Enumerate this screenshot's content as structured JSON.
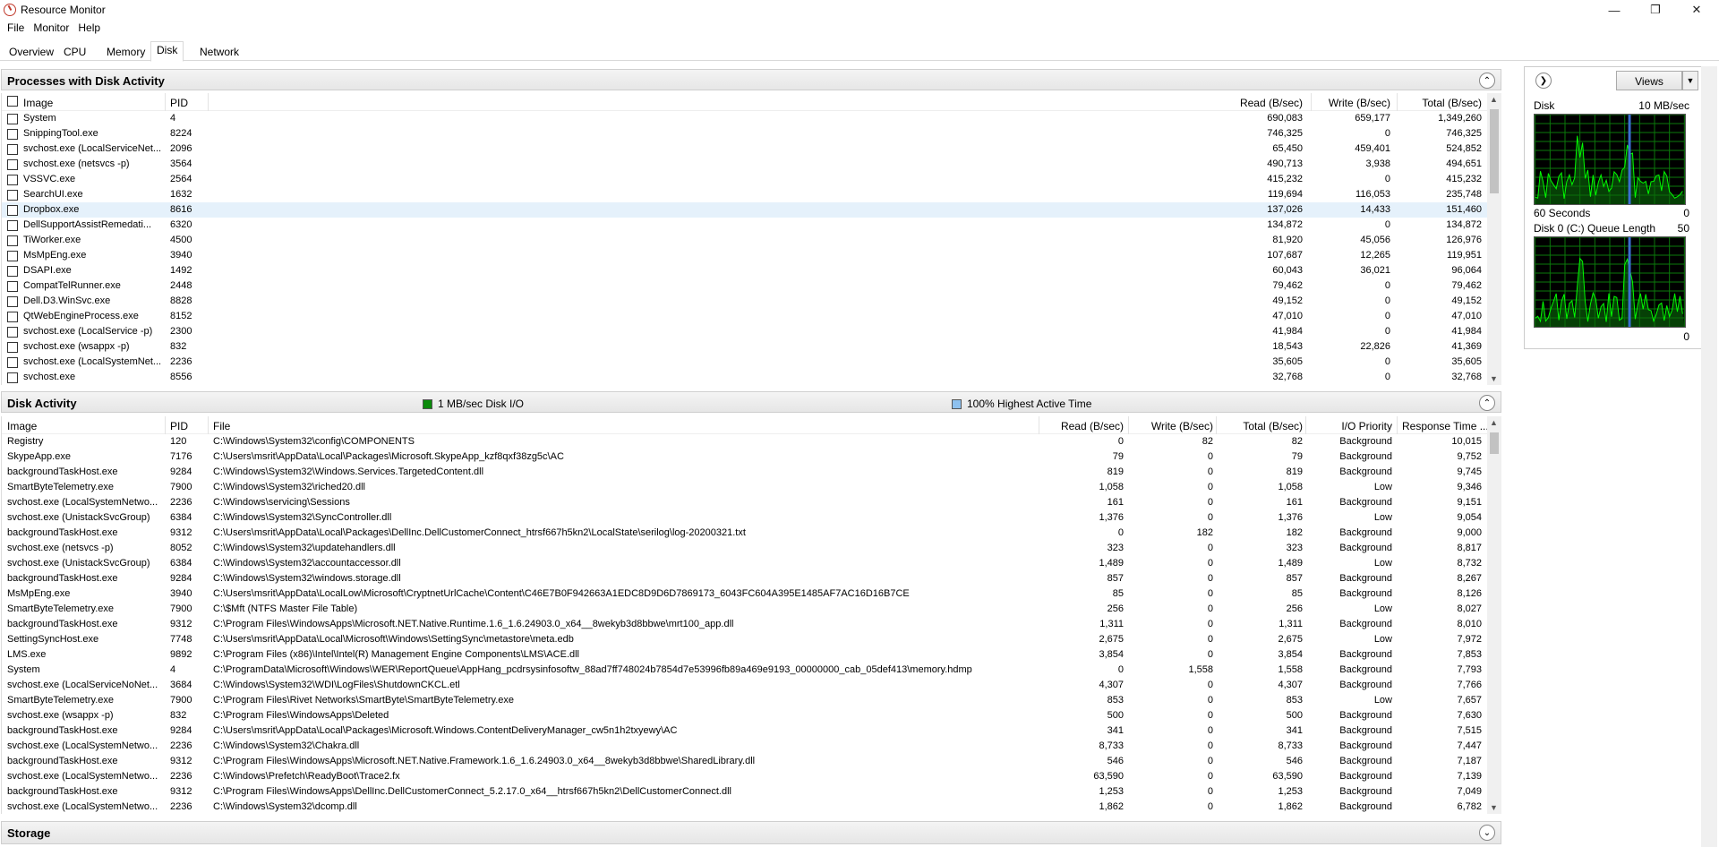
{
  "window": {
    "title": "Resource Monitor",
    "minimize": "—",
    "maximize": "❐",
    "close": "✕"
  },
  "menu": [
    "File",
    "Monitor",
    "Help"
  ],
  "tabs": [
    "Overview",
    "CPU",
    "Memory",
    "Disk",
    "Network"
  ],
  "processes": {
    "title": "Processes with Disk Activity",
    "columns": {
      "image": "Image",
      "pid": "PID",
      "read": "Read (B/sec)",
      "write": "Write (B/sec)",
      "total": "Total (B/sec)"
    },
    "rows": [
      {
        "image": "System",
        "pid": "4",
        "read": "690,083",
        "write": "659,177",
        "total": "1,349,260"
      },
      {
        "image": "SnippingTool.exe",
        "pid": "8224",
        "read": "746,325",
        "write": "0",
        "total": "746,325"
      },
      {
        "image": "svchost.exe (LocalServiceNet...",
        "pid": "2096",
        "read": "65,450",
        "write": "459,401",
        "total": "524,852"
      },
      {
        "image": "svchost.exe (netsvcs -p)",
        "pid": "3564",
        "read": "490,713",
        "write": "3,938",
        "total": "494,651"
      },
      {
        "image": "VSSVC.exe",
        "pid": "2564",
        "read": "415,232",
        "write": "0",
        "total": "415,232"
      },
      {
        "image": "SearchUI.exe",
        "pid": "1632",
        "read": "119,694",
        "write": "116,053",
        "total": "235,748"
      },
      {
        "image": "Dropbox.exe",
        "pid": "8616",
        "read": "137,026",
        "write": "14,433",
        "total": "151,460"
      },
      {
        "image": "DellSupportAssistRemedati...",
        "pid": "6320",
        "read": "134,872",
        "write": "0",
        "total": "134,872"
      },
      {
        "image": "TiWorker.exe",
        "pid": "4500",
        "read": "81,920",
        "write": "45,056",
        "total": "126,976"
      },
      {
        "image": "MsMpEng.exe",
        "pid": "3940",
        "read": "107,687",
        "write": "12,265",
        "total": "119,951"
      },
      {
        "image": "DSAPI.exe",
        "pid": "1492",
        "read": "60,043",
        "write": "36,021",
        "total": "96,064"
      },
      {
        "image": "CompatTelRunner.exe",
        "pid": "2448",
        "read": "79,462",
        "write": "0",
        "total": "79,462"
      },
      {
        "image": "Dell.D3.WinSvc.exe",
        "pid": "8828",
        "read": "49,152",
        "write": "0",
        "total": "49,152"
      },
      {
        "image": "QtWebEngineProcess.exe",
        "pid": "8152",
        "read": "47,010",
        "write": "0",
        "total": "47,010"
      },
      {
        "image": "svchost.exe (LocalService -p)",
        "pid": "2300",
        "read": "41,984",
        "write": "0",
        "total": "41,984"
      },
      {
        "image": "svchost.exe (wsappx -p)",
        "pid": "832",
        "read": "18,543",
        "write": "22,826",
        "total": "41,369"
      },
      {
        "image": "svchost.exe (LocalSystemNet...",
        "pid": "2236",
        "read": "35,605",
        "write": "0",
        "total": "35,605"
      },
      {
        "image": "svchost.exe",
        "pid": "8556",
        "read": "32,768",
        "write": "0",
        "total": "32,768"
      }
    ]
  },
  "disk_activity": {
    "title": "Disk Activity",
    "legend_io": "1 MB/sec Disk I/O",
    "legend_active": "100% Highest Active Time",
    "colors": {
      "io": "#0a8a0a",
      "active": "#8ec1ef",
      "graph_line": "#00ff00",
      "graph_grid": "#0b7a0b"
    },
    "columns": {
      "image": "Image",
      "pid": "PID",
      "file": "File",
      "read": "Read (B/sec)",
      "write": "Write (B/sec)",
      "total": "Total (B/sec)",
      "priority": "I/O Priority",
      "response": "Response Time ..."
    },
    "rows": [
      {
        "image": "Registry",
        "pid": "120",
        "file": "C:\\Windows\\System32\\config\\COMPONENTS",
        "read": "0",
        "write": "82",
        "total": "82",
        "priority": "Background",
        "response": "10,015"
      },
      {
        "image": "SkypeApp.exe",
        "pid": "7176",
        "file": "C:\\Users\\msrit\\AppData\\Local\\Packages\\Microsoft.SkypeApp_kzf8qxf38zg5c\\AC",
        "read": "79",
        "write": "0",
        "total": "79",
        "priority": "Background",
        "response": "9,752"
      },
      {
        "image": "backgroundTaskHost.exe",
        "pid": "9284",
        "file": "C:\\Windows\\System32\\Windows.Services.TargetedContent.dll",
        "read": "819",
        "write": "0",
        "total": "819",
        "priority": "Background",
        "response": "9,745"
      },
      {
        "image": "SmartByteTelemetry.exe",
        "pid": "7900",
        "file": "C:\\Windows\\System32\\riched20.dll",
        "read": "1,058",
        "write": "0",
        "total": "1,058",
        "priority": "Low",
        "response": "9,346"
      },
      {
        "image": "svchost.exe (LocalSystemNetwo...",
        "pid": "2236",
        "file": "C:\\Windows\\servicing\\Sessions",
        "read": "161",
        "write": "0",
        "total": "161",
        "priority": "Background",
        "response": "9,151"
      },
      {
        "image": "svchost.exe (UnistackSvcGroup)",
        "pid": "6384",
        "file": "C:\\Windows\\System32\\SyncController.dll",
        "read": "1,376",
        "write": "0",
        "total": "1,376",
        "priority": "Low",
        "response": "9,054"
      },
      {
        "image": "backgroundTaskHost.exe",
        "pid": "9312",
        "file": "C:\\Users\\msrit\\AppData\\Local\\Packages\\DellInc.DellCustomerConnect_htrsf667h5kn2\\LocalState\\serilog\\log-20200321.txt",
        "read": "0",
        "write": "182",
        "total": "182",
        "priority": "Background",
        "response": "9,000"
      },
      {
        "image": "svchost.exe (netsvcs -p)",
        "pid": "8052",
        "file": "C:\\Windows\\System32\\updatehandlers.dll",
        "read": "323",
        "write": "0",
        "total": "323",
        "priority": "Background",
        "response": "8,817"
      },
      {
        "image": "svchost.exe (UnistackSvcGroup)",
        "pid": "6384",
        "file": "C:\\Windows\\System32\\accountaccessor.dll",
        "read": "1,489",
        "write": "0",
        "total": "1,489",
        "priority": "Low",
        "response": "8,732"
      },
      {
        "image": "backgroundTaskHost.exe",
        "pid": "9284",
        "file": "C:\\Windows\\System32\\windows.storage.dll",
        "read": "857",
        "write": "0",
        "total": "857",
        "priority": "Background",
        "response": "8,267"
      },
      {
        "image": "MsMpEng.exe",
        "pid": "3940",
        "file": "C:\\Users\\msrit\\AppData\\LocalLow\\Microsoft\\CryptnetUrlCache\\Content\\C46E7B0F942663A1EDC8D9D6D7869173_6043FC604A395E1485AF7AC16D16B7CE",
        "read": "85",
        "write": "0",
        "total": "85",
        "priority": "Background",
        "response": "8,126"
      },
      {
        "image": "SmartByteTelemetry.exe",
        "pid": "7900",
        "file": "C:\\$Mft (NTFS Master File Table)",
        "read": "256",
        "write": "0",
        "total": "256",
        "priority": "Low",
        "response": "8,027"
      },
      {
        "image": "backgroundTaskHost.exe",
        "pid": "9312",
        "file": "C:\\Program Files\\WindowsApps\\Microsoft.NET.Native.Runtime.1.6_1.6.24903.0_x64__8wekyb3d8bbwe\\mrt100_app.dll",
        "read": "1,311",
        "write": "0",
        "total": "1,311",
        "priority": "Background",
        "response": "8,010"
      },
      {
        "image": "SettingSyncHost.exe",
        "pid": "7748",
        "file": "C:\\Users\\msrit\\AppData\\Local\\Microsoft\\Windows\\SettingSync\\metastore\\meta.edb",
        "read": "2,675",
        "write": "0",
        "total": "2,675",
        "priority": "Low",
        "response": "7,972"
      },
      {
        "image": "LMS.exe",
        "pid": "9892",
        "file": "C:\\Program Files (x86)\\Intel\\Intel(R) Management Engine Components\\LMS\\ACE.dll",
        "read": "3,854",
        "write": "0",
        "total": "3,854",
        "priority": "Background",
        "response": "7,853"
      },
      {
        "image": "System",
        "pid": "4",
        "file": "C:\\ProgramData\\Microsoft\\Windows\\WER\\ReportQueue\\AppHang_pcdrsysinfosoftw_88ad7ff748024b7854d7e53996fb89a469e9193_00000000_cab_05def413\\memory.hdmp",
        "read": "0",
        "write": "1,558",
        "total": "1,558",
        "priority": "Background",
        "response": "7,793"
      },
      {
        "image": "svchost.exe (LocalServiceNoNet...",
        "pid": "3684",
        "file": "C:\\Windows\\System32\\WDI\\LogFiles\\ShutdownCKCL.etl",
        "read": "4,307",
        "write": "0",
        "total": "4,307",
        "priority": "Background",
        "response": "7,766"
      },
      {
        "image": "SmartByteTelemetry.exe",
        "pid": "7900",
        "file": "C:\\Program Files\\Rivet Networks\\SmartByte\\SmartByteTelemetry.exe",
        "read": "853",
        "write": "0",
        "total": "853",
        "priority": "Low",
        "response": "7,657"
      },
      {
        "image": "svchost.exe (wsappx -p)",
        "pid": "832",
        "file": "C:\\Program Files\\WindowsApps\\Deleted",
        "read": "500",
        "write": "0",
        "total": "500",
        "priority": "Background",
        "response": "7,630"
      },
      {
        "image": "backgroundTaskHost.exe",
        "pid": "9284",
        "file": "C:\\Users\\msrit\\AppData\\Local\\Packages\\Microsoft.Windows.ContentDeliveryManager_cw5n1h2txyewy\\AC",
        "read": "341",
        "write": "0",
        "total": "341",
        "priority": "Background",
        "response": "7,515"
      },
      {
        "image": "svchost.exe (LocalSystemNetwo...",
        "pid": "2236",
        "file": "C:\\Windows\\System32\\Chakra.dll",
        "read": "8,733",
        "write": "0",
        "total": "8,733",
        "priority": "Background",
        "response": "7,447"
      },
      {
        "image": "backgroundTaskHost.exe",
        "pid": "9312",
        "file": "C:\\Program Files\\WindowsApps\\Microsoft.NET.Native.Framework.1.6_1.6.24903.0_x64__8wekyb3d8bbwe\\SharedLibrary.dll",
        "read": "546",
        "write": "0",
        "total": "546",
        "priority": "Background",
        "response": "7,187"
      },
      {
        "image": "svchost.exe (LocalSystemNetwo...",
        "pid": "2236",
        "file": "C:\\Windows\\Prefetch\\ReadyBoot\\Trace2.fx",
        "read": "63,590",
        "write": "0",
        "total": "63,590",
        "priority": "Background",
        "response": "7,139"
      },
      {
        "image": "backgroundTaskHost.exe",
        "pid": "9312",
        "file": "C:\\Program Files\\WindowsApps\\DellInc.DellCustomerConnect_5.2.17.0_x64__htrsf667h5kn2\\DellCustomerConnect.dll",
        "read": "1,253",
        "write": "0",
        "total": "1,253",
        "priority": "Background",
        "response": "7,049"
      },
      {
        "image": "svchost.exe (LocalSystemNetwo...",
        "pid": "2236",
        "file": "C:\\Windows\\System32\\dcomp.dll",
        "read": "1,862",
        "write": "0",
        "total": "1,862",
        "priority": "Background",
        "response": "6,782"
      }
    ]
  },
  "storage": {
    "title": "Storage"
  },
  "side": {
    "views_label": "Views",
    "disk_graph": {
      "title": "Disk",
      "scale": "10 MB/sec",
      "footer_left": "60 Seconds",
      "footer_right": "0"
    },
    "queue_graph": {
      "title": "Disk 0 (C:) Queue Length",
      "scale": "50",
      "footer_right": "0"
    }
  }
}
